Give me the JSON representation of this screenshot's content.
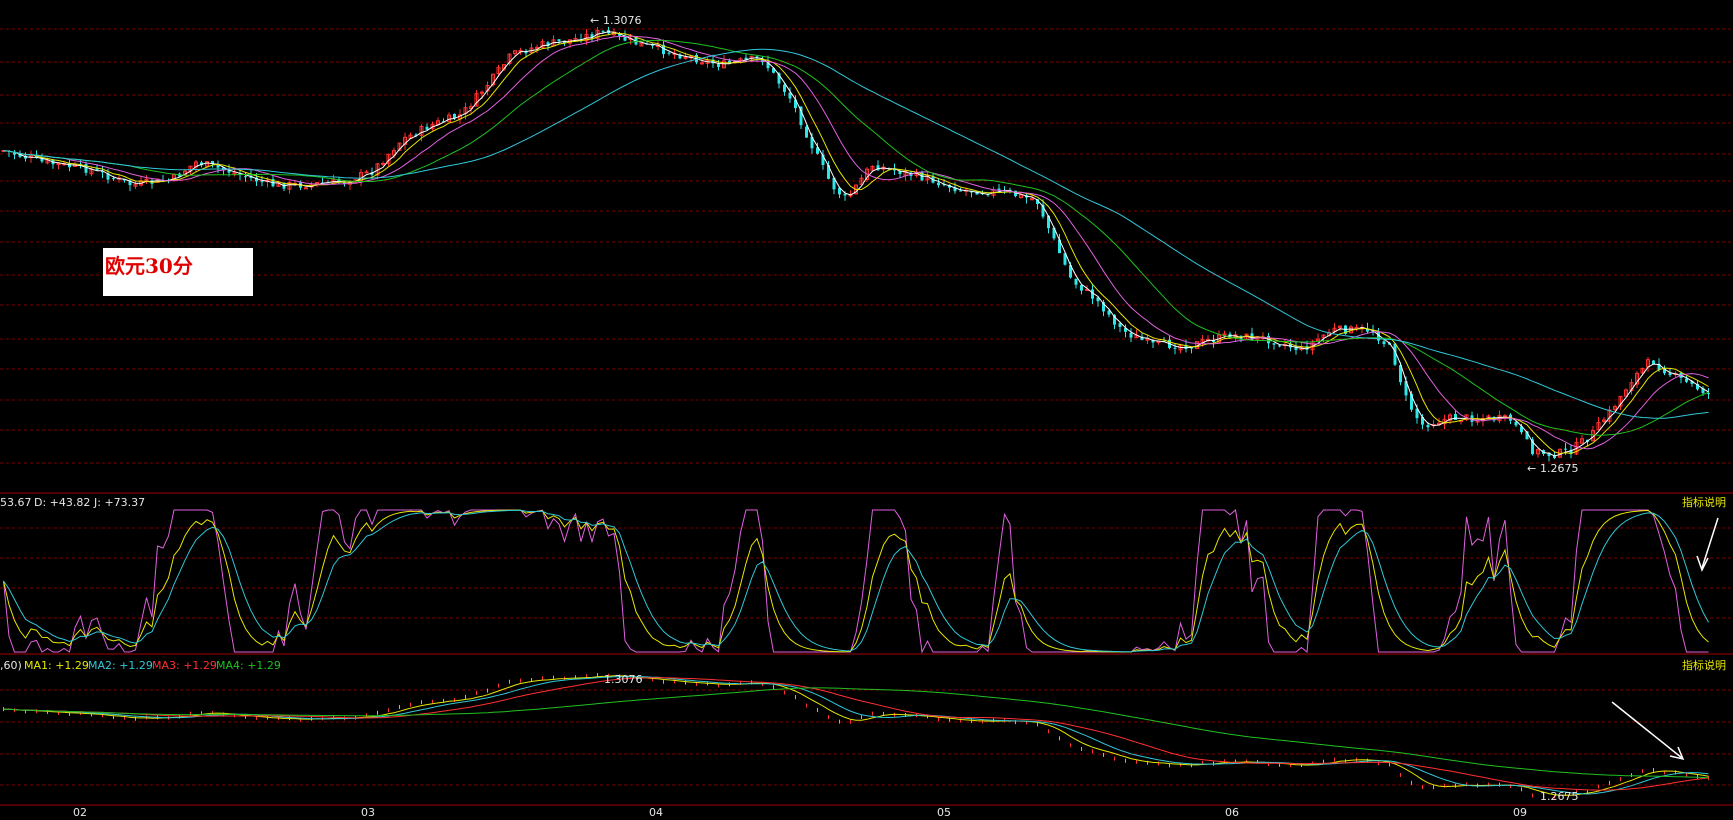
{
  "title": "欧元30分",
  "colors": {
    "background": "#000000",
    "grid": "#7a0000",
    "panel_border": "#a00000",
    "up": "#ff3030",
    "down": "#2ee6e6",
    "ma_white": "#ffffff",
    "ma_yellow": "#e6e600",
    "ma_magenta": "#e060e0",
    "ma_green": "#20c020",
    "ma_cyan": "#30c8d8",
    "kdj_k": "#e6e6e6",
    "kdj_d": "#e6e600",
    "kdj_j": "#e060e0",
    "label_yellow": "#e6e600"
  },
  "chart_data": [
    {
      "type": "candlestick",
      "panel": "price",
      "title": "欧元30分",
      "annotations": [
        {
          "text": "1.3076",
          "x": 0.35,
          "y": 1.3076
        },
        {
          "text": "1.2675",
          "x": 0.885,
          "y": 1.2675
        }
      ],
      "ylim": [
        1.2675,
        1.3076
      ],
      "grid": true,
      "moving_averages": [
        "white",
        "yellow",
        "magenta",
        "green",
        "cyan"
      ]
    },
    {
      "type": "line",
      "panel": "KDJ",
      "header": {
        "k_text": "53.67",
        "d_text": "D: +43.82",
        "j_text": "J: +73.37"
      },
      "series": [
        {
          "name": "K",
          "color": "#e6e6e6"
        },
        {
          "name": "D",
          "color": "#e6e600"
        },
        {
          "name": "J",
          "color": "#e060e0"
        }
      ],
      "ylim": [
        0,
        100
      ],
      "note_label": "指标说明"
    },
    {
      "type": "line",
      "panel": "MA",
      "header": {
        "params_text": ",60)",
        "ma1": "MA1: +1.29",
        "ma2": "MA2: +1.29",
        "ma3": "MA3: +1.29",
        "ma4": "MA4: +1.29"
      },
      "annotations": [
        {
          "text": "1.3076"
        },
        {
          "text": "1.2675"
        }
      ],
      "note_label": "指标说明"
    }
  ],
  "x_axis": {
    "ticks": [
      "02",
      "03",
      "04",
      "05",
      "06",
      "09"
    ]
  }
}
